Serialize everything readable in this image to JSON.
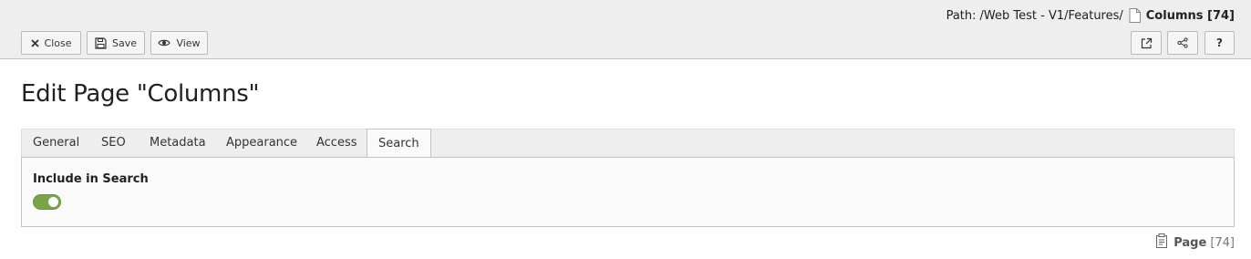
{
  "header": {
    "path_label": "Path:",
    "path_value": "/Web Test - V1/Features/",
    "current_page": "Columns [74]"
  },
  "toolbar": {
    "close_label": "Close",
    "save_label": "Save",
    "view_label": "View",
    "help_label": "?"
  },
  "page": {
    "title": "Edit Page \"Columns\""
  },
  "tabs": [
    {
      "label": "General"
    },
    {
      "label": "SEO"
    },
    {
      "label": "Metadata"
    },
    {
      "label": "Appearance"
    },
    {
      "label": "Access"
    },
    {
      "label": "Search",
      "active": true
    }
  ],
  "search_panel": {
    "include_label": "Include in Search",
    "include_enabled": true
  },
  "footer": {
    "record_type": "Page",
    "record_uid": "[74]"
  },
  "colors": {
    "toggle_on": "#79a548",
    "header_bg": "#eeeeee"
  }
}
